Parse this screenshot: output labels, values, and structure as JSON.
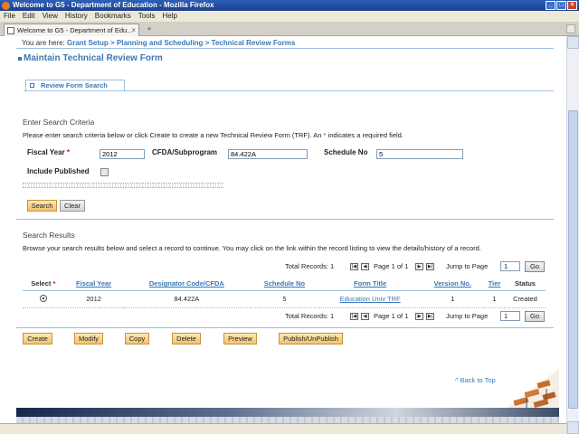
{
  "window": {
    "title": "Welcome to G5 - Department of Education - Mozilla Firefox"
  },
  "menu": [
    "File",
    "Edit",
    "View",
    "History",
    "Bookmarks",
    "Tools",
    "Help"
  ],
  "browser_tab": {
    "label": "Welcome to G5 - Department of Edu...",
    "new_tab": "+"
  },
  "breadcrumb": {
    "prefix": "You are here:",
    "path": "Grant Setup > Planning and Scheduling > Technical Review Forms"
  },
  "page_title": "Maintain Technical Review Form",
  "form_tab": "Review Form Search",
  "criteria": {
    "heading": "Enter Search Criteria",
    "help_a": "Please enter search criteria below or click Create to create a new Technical Review Form (TRF). An",
    "help_star": "*",
    "help_b": "indicates a required field.",
    "fiscal_year_label": "Fiscal Year",
    "req_mark": "*",
    "fiscal_year_value": "2012",
    "cfda_label": "CFDA/Subprogram",
    "cfda_value": "84.422A",
    "schedule_label": "Schedule No",
    "schedule_value": "5",
    "include_published_label": "Include Published",
    "search_btn": "Search",
    "clear_btn": "Clear"
  },
  "results": {
    "heading": "Search Results",
    "help": "Browse your search results below and select a record to continue. You may click on the link within the record listing to view the details/history of a record.",
    "total_label": "Total Records: 1",
    "page_label": "Page 1 of 1",
    "jump_label": "Jump to Page",
    "jump_value": "1",
    "go": "Go",
    "columns": {
      "select": "Select",
      "fiscal_year": "Fiscal Year",
      "designator": "Designator Code/CFDA",
      "schedule": "Schedule No",
      "title": "Form Title",
      "version": "Version No.",
      "tier": "Tier",
      "status": "Status"
    },
    "row": {
      "fiscal_year": "2012",
      "designator": "84.422A",
      "schedule": "5",
      "title": "Education Univ TRF",
      "version": "1",
      "tier": "1",
      "status": "Created"
    }
  },
  "actions": {
    "create": "Create",
    "modify": "Modify",
    "copy": "Copy",
    "delete": "Delete",
    "preview": "Preview",
    "publish": "Publish/UnPublish"
  },
  "back_to_top": "^ Back to Top"
}
